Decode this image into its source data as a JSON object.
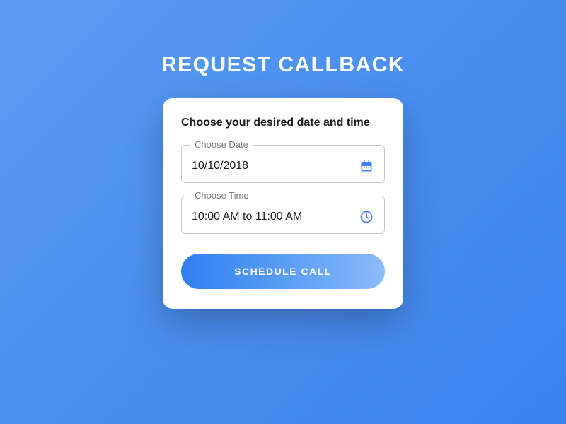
{
  "page_title": "REQUEST CALLBACK",
  "card": {
    "heading": "Choose your desired date and time",
    "date_field": {
      "label": "Choose Date",
      "value": "10/10/2018"
    },
    "time_field": {
      "label": "Choose Time",
      "value": "10:00 AM to 11:00 AM"
    },
    "submit_label": "SCHEDULE CALL"
  },
  "colors": {
    "accent": "#3d82ed",
    "icon": "#3d82ed"
  }
}
